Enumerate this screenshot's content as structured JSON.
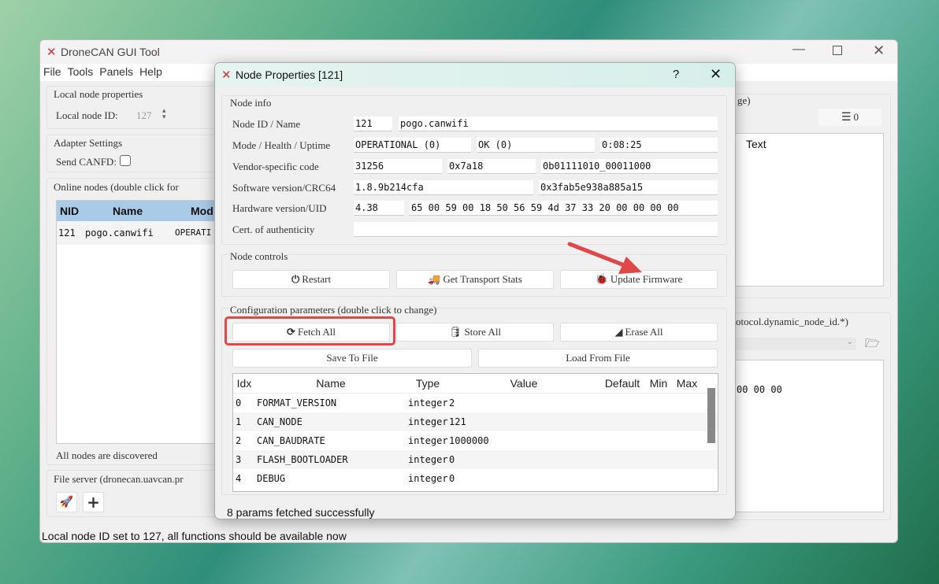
{
  "main": {
    "title": "DroneCAN GUI Tool",
    "menu": [
      "File",
      "Tools",
      "Panels",
      "Help"
    ],
    "local_node": {
      "group": "Local node properties",
      "id_label": "Local node ID:",
      "id_value": "127"
    },
    "adapter": {
      "group": "Adapter Settings",
      "canfd_label": "Send CANFD:"
    },
    "online": {
      "group": "Online nodes (double click for",
      "headers": [
        "NID",
        "Name",
        "Mod"
      ],
      "rows": [
        {
          "nid": "121",
          "name": "pogo.canwifi",
          "mode": "OPERATI"
        }
      ],
      "status": "All nodes are discovered"
    },
    "file_server": {
      "group": "File server (dronecan.uavcan.pr"
    },
    "right_top": {
      "group_tail": "ge)",
      "count_button": "0",
      "text_header": "Text"
    },
    "right_bottom": {
      "group_tail": "otocol.dynamic_node_id.*)",
      "text": "00 00 00"
    },
    "status": "Local node ID set to 127, all functions should be available now"
  },
  "dialog": {
    "title": "Node Properties [121]",
    "help": "?",
    "node_info": {
      "group": "Node info",
      "labels": [
        "Node ID / Name",
        "Mode / Health / Uptime",
        "Vendor-specific code",
        "Software version/CRC64",
        "Hardware version/UID",
        "Cert. of authenticity"
      ],
      "node_id": "121",
      "name": "pogo.canwifi",
      "mode": "OPERATIONAL (0)",
      "health": "OK (0)",
      "uptime": "0:08:25",
      "vendor_dec": "31256",
      "vendor_hex": "0x7a18",
      "vendor_bin": "0b01111010_00011000",
      "sw_version": "1.8.9b214cfa",
      "crc64": "0x3fab5e938a885a15",
      "hw_version": "4.38",
      "uid": "65 00 59 00 18 50 56 59 4d 37 33 20 00 00 00 00",
      "cert": ""
    },
    "controls": {
      "group": "Node controls",
      "restart": "Restart",
      "transport": "Get Transport Stats",
      "update": "Update Firmware"
    },
    "config": {
      "group": "Configuration parameters (double click to change)",
      "fetch": "Fetch All",
      "store": "Store All",
      "erase": "Erase All",
      "save": "Save To File",
      "load": "Load From File",
      "headers": [
        "Idx",
        "Name",
        "Type",
        "Value",
        "Default",
        "Min",
        "Max"
      ],
      "rows": [
        {
          "idx": "0",
          "name": "FORMAT_VERSION",
          "type": "integer",
          "value": "2"
        },
        {
          "idx": "1",
          "name": "CAN_NODE",
          "type": "integer",
          "value": "121"
        },
        {
          "idx": "2",
          "name": "CAN_BAUDRATE",
          "type": "integer",
          "value": "1000000"
        },
        {
          "idx": "3",
          "name": "FLASH_BOOTLOADER",
          "type": "integer",
          "value": "0"
        },
        {
          "idx": "4",
          "name": "DEBUG",
          "type": "integer",
          "value": "0"
        }
      ]
    },
    "status": "8 params fetched successfully"
  },
  "colors": {
    "highlight": "#e04848",
    "header_blue": "#a9cbe8"
  }
}
